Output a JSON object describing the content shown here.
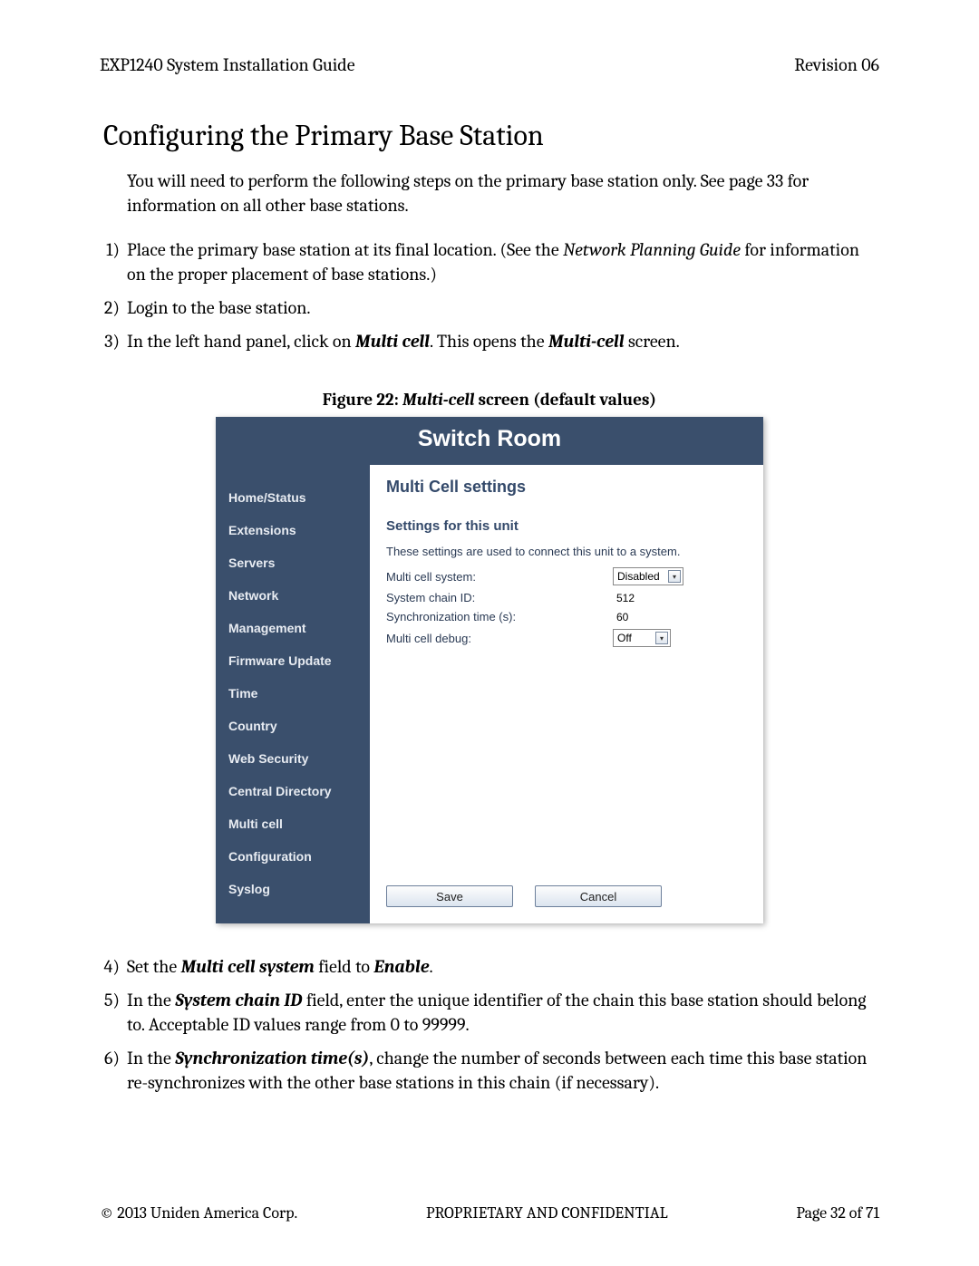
{
  "header": {
    "left": "EXP1240 System Installation Guide",
    "right": "Revision 06"
  },
  "title": "Configuring the Primary Base Station",
  "intro": "You will need to perform the following steps on the primary base station only. See page 33 for information on all other base stations.",
  "steps_a": [
    {
      "num": "1)",
      "pre": "Place the primary base station at its final location. (See the ",
      "em": "Network Planning Guide",
      "post": " for information on the proper placement of base stations.)"
    },
    {
      "num": "2)",
      "pre": "Login to the base station.",
      "em": "",
      "post": ""
    },
    {
      "num": "3)",
      "pre": "In the left hand panel, click on ",
      "em": "Multi cell",
      "post_pre": ". This opens the ",
      "em2": "Multi-cell",
      "post": " screen."
    }
  ],
  "figure": {
    "label_prefix": "Figure 22: ",
    "label_em": "Multi-cell",
    "label_suffix": " screen (default values)"
  },
  "ui": {
    "title": "Switch Room",
    "nav": [
      "Home/Status",
      "Extensions",
      "Servers",
      "Network",
      "Management",
      "Firmware Update",
      "Time",
      "Country",
      "Web Security",
      "Central Directory",
      "Multi cell",
      "Configuration",
      "Syslog"
    ],
    "main": {
      "heading": "Multi Cell settings",
      "sub": "Settings for this unit",
      "desc": "These settings are used to connect this unit to a system.",
      "rows": [
        {
          "label": "Multi cell system:",
          "type": "select",
          "value": "Disabled",
          "width": 78
        },
        {
          "label": "System chain ID:",
          "type": "text",
          "value": "512"
        },
        {
          "label": "Synchronization time (s):",
          "type": "text",
          "value": "60"
        },
        {
          "label": "Multi cell debug:",
          "type": "select",
          "value": "Off",
          "width": 64
        }
      ],
      "buttons": {
        "save": "Save",
        "cancel": "Cancel"
      }
    }
  },
  "steps_b": [
    {
      "num": "4)",
      "pre": "Set the ",
      "em": "Multi cell system",
      "mid": " field to ",
      "em2": "Enable",
      "post": "."
    },
    {
      "num": "5)",
      "pre": "In the ",
      "em": "System chain ID",
      "post": " field, enter the unique identifier of the chain this base station should belong to. Acceptable ID values range from 0 to 99999."
    },
    {
      "num": "6)",
      "pre": "In the ",
      "em": "Synchronization time(s)",
      "post": ", change the number of seconds between each time this base station re-synchronizes with the other base stations in this chain (if necessary)."
    }
  ],
  "footer": {
    "left": "© 2013 Uniden America Corp.",
    "center": "PROPRIETARY AND CONFIDENTIAL",
    "right": "Page 32 of 71"
  }
}
